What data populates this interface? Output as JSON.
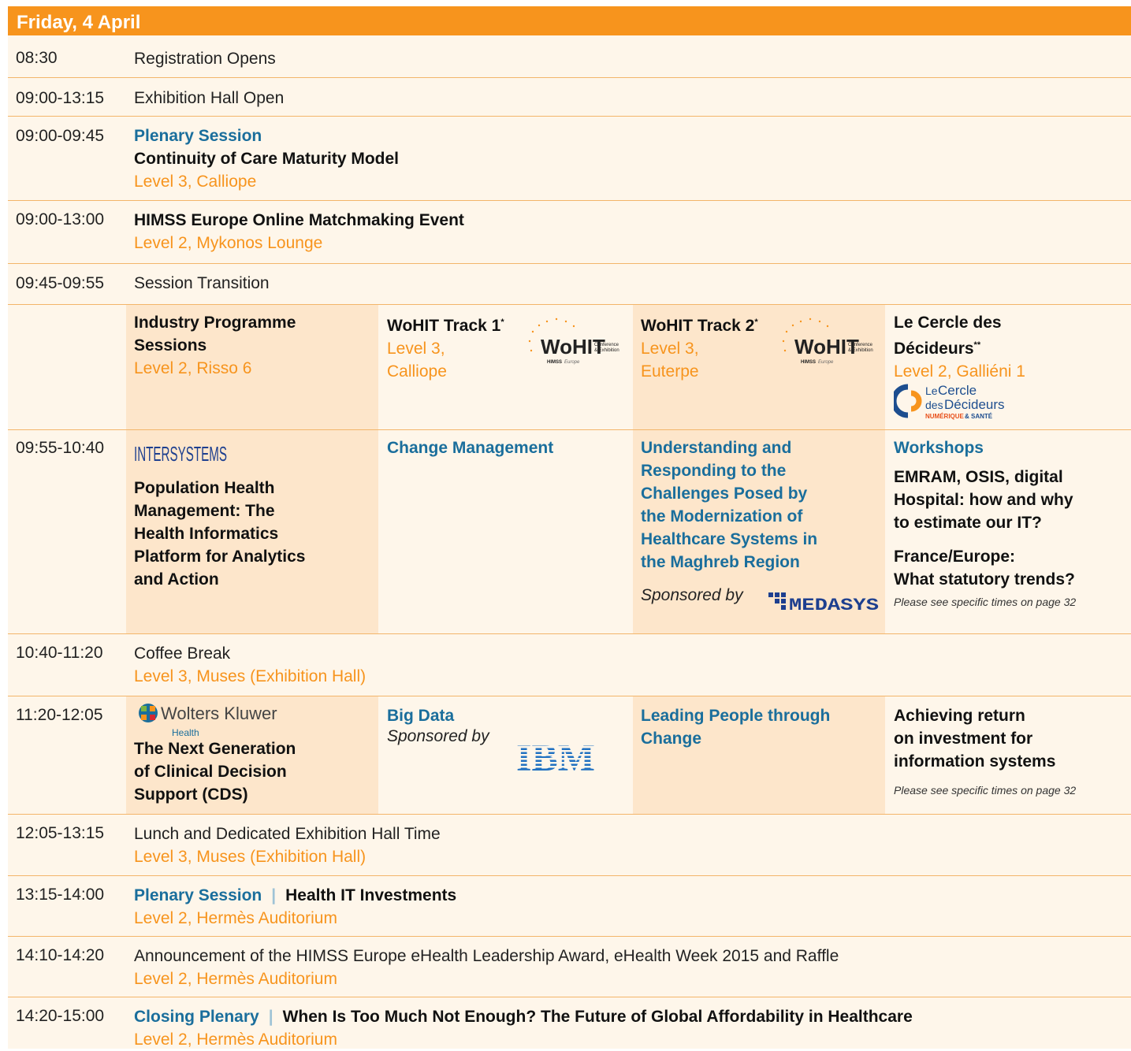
{
  "header": {
    "title": "Friday, 4 April"
  },
  "rows": {
    "r1": {
      "time": "08:30",
      "text": "Registration Opens"
    },
    "r2": {
      "time": "09:00-13:15",
      "text": "Exhibition Hall Open"
    },
    "r3": {
      "time": "09:00-09:45",
      "label": "Plenary Session",
      "title": "Continuity of Care Maturity Model",
      "loc": "Level 3, Calliope"
    },
    "r4": {
      "time": "09:00-13:00",
      "title": "HIMSS Europe Online Matchmaking Event",
      "loc": "Level 2, Mykonos Lounge"
    },
    "r5": {
      "time": "09:45-09:55",
      "text": "Session Transition"
    },
    "r7": {
      "time": "10:40-11:20",
      "text": "Coffee Break",
      "loc": "Level 3, Muses (Exhibition Hall)"
    },
    "r9": {
      "time": "12:05-13:15",
      "text": "Lunch and Dedicated Exhibition Hall Time",
      "loc": "Level 3, Muses (Exhibition Hall)"
    },
    "r10": {
      "time": "13:15-14:00",
      "label": "Plenary Session",
      "sep": "|",
      "title": "Health IT Investments",
      "loc": "Level 2, Hermès Auditorium"
    },
    "r11": {
      "time": "14:10-14:20",
      "text": "Announcement of the HIMSS Europe eHealth Leadership Award, eHealth Week 2015 and Raffle",
      "loc": "Level 2, Hermès Auditorium"
    },
    "r12": {
      "time": "14:20-15:00",
      "label": "Closing Plenary",
      "sep": "|",
      "title": "When Is Too Much Not Enough? The Future of Global Affordability in Healthcare",
      "loc": "Level 2, Hermès Auditorium"
    }
  },
  "tracks": {
    "c1": {
      "title_a": "Industry Programme",
      "title_b": "Sessions",
      "loc": "Level 2, Risso 6"
    },
    "c2": {
      "title": "WoHIT Track 1",
      "sup": "*",
      "loc_a": "Level 3,",
      "loc_b": "Calliope"
    },
    "c3": {
      "title": "WoHIT Track 2",
      "sup": "*",
      "loc_a": "Level 3,",
      "loc_b": "Euterpe"
    },
    "c4": {
      "title_a": "Le Cercle des",
      "title_b": "Décideurs",
      "sup": "**",
      "loc": "Level 2, Galliéni 1"
    }
  },
  "logos": {
    "wohit_text": "WoHIT",
    "wohit_sub1": "Conference",
    "wohit_sub2": "& Exhibition",
    "wohit_himss": "HIMSS",
    "wohit_europe": "Europe",
    "cercle_le": "Le",
    "cercle_cercle": "Cercle",
    "cercle_des": "des",
    "cercle_decideurs": "Décideurs",
    "cercle_tag1": "NUMÉRIQUE",
    "cercle_tag2": "& SANTÉ",
    "intersystems": "INTERSYSTEMS",
    "medasys": "MEDASYS",
    "wk": "Wolters Kluwer",
    "wk_sub": "Health",
    "ibm": "IBM"
  },
  "r6": {
    "time": "09:55-10:40",
    "c1": {
      "title": [
        "Population Health",
        "Management: The",
        "Health Informatics",
        "Platform for Analytics",
        "and Action"
      ]
    },
    "c2": {
      "blue": "Change Management"
    },
    "c3": {
      "blue": [
        "Understanding and",
        "Responding to the",
        "Challenges Posed by",
        "the Modernization of",
        "Healthcare Systems in",
        "the Maghreb Region"
      ],
      "sponsored": "Sponsored by"
    },
    "c4": {
      "blue": "Workshops",
      "t1": [
        "EMRAM, OSIS, digital",
        "Hospital: how and why",
        "to estimate our IT?"
      ],
      "t2": [
        "France/Europe:",
        "What statutory trends?"
      ],
      "note": "Please see specific times on page 32"
    }
  },
  "r8": {
    "time": "11:20-12:05",
    "c1": {
      "title": [
        "The Next Generation",
        "of Clinical Decision",
        "Support (CDS)"
      ]
    },
    "c2": {
      "blue": "Big Data",
      "sponsored": "Sponsored by"
    },
    "c3": {
      "blue": [
        "Leading People through",
        "Change"
      ]
    },
    "c4": {
      "title": [
        "Achieving return",
        "on investment for",
        "information systems"
      ],
      "note": "Please see specific times on page 32"
    }
  }
}
